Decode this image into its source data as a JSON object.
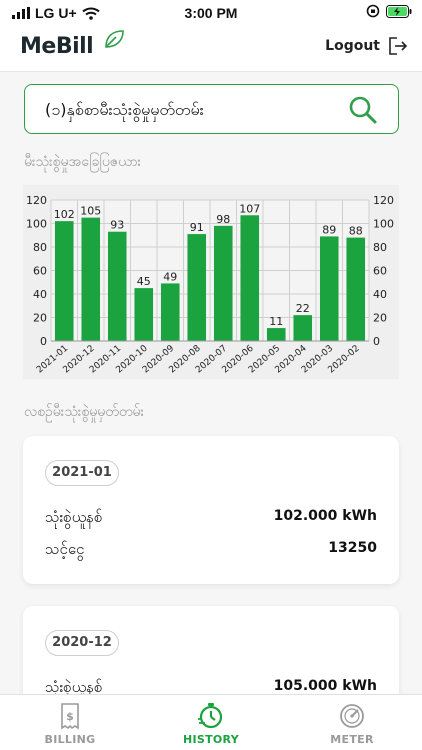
{
  "status_bar": {
    "carrier": "LG U+",
    "time": "3:00 PM"
  },
  "app": {
    "logo": "MeBill",
    "logout_label": "Logout"
  },
  "search": {
    "value": "(၁)နှစ်စာမီးသုံးစွဲမှုမှတ်တမ်း"
  },
  "sections": {
    "chart_title": "မီးသုံးစွဲမှုအခြေပြဇယား",
    "history_title": "လစဉ်မီးသုံးစွဲမှုမှတ်တမ်း"
  },
  "chart_data": {
    "type": "bar",
    "categories": [
      "2021-01",
      "2020-12",
      "2020-11",
      "2020-10",
      "2020-09",
      "2020-08",
      "2020-07",
      "2020-06",
      "2020-05",
      "2020-04",
      "2020-03",
      "2020-02"
    ],
    "values": [
      102,
      105,
      93,
      45,
      49,
      91,
      98,
      107,
      11,
      22,
      89,
      88
    ],
    "ylim": [
      0,
      120
    ],
    "yticks": [
      "0",
      "20",
      "40",
      "60",
      "80",
      "100",
      "120"
    ],
    "bar_color": "#1aa33f",
    "grid": true,
    "dual_y_axis": true
  },
  "records": [
    {
      "month": "2021-01",
      "usage_label": "သုံးစွဲယူနစ်",
      "usage_value": "102.000 kWh",
      "amount_label": "သင့်ငွေ",
      "amount_value": "13250"
    },
    {
      "month": "2020-12",
      "usage_label": "သုံးစွဲယူနစ်",
      "usage_value": "105.000 kWh"
    }
  ],
  "tabs": [
    {
      "label": "BILLING",
      "icon": "receipt-dollar-icon",
      "active": false
    },
    {
      "label": "HISTORY",
      "icon": "history-timer-icon",
      "active": true
    },
    {
      "label": "METER",
      "icon": "gauge-meter-icon",
      "active": false
    }
  ],
  "colors": {
    "accent": "#1aa33f",
    "inactive": "#9a9a9a"
  }
}
